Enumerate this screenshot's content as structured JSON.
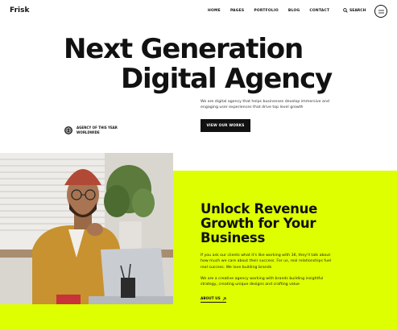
{
  "header": {
    "logo": "Frisk",
    "nav": [
      "HOME",
      "PAGES",
      "PORTFOLIO",
      "BLOG",
      "CONTACT"
    ],
    "search_label": "SEARCH"
  },
  "hero": {
    "line1": "Next Generation",
    "line2": "Digital Agency",
    "description": "We are digital agency that helps businesses develop immersive and engaging user experiences that drive top level growth",
    "cta_label": "VIEW OUR WORKS",
    "award_line1": "AGENCY OF THIS YEAR",
    "award_line2": "WORLDWIDE"
  },
  "section": {
    "title_line1": "Unlock Revenue",
    "title_line2": "Growth for Your",
    "title_line3": "Business",
    "paragraph1": "If you ask our clients what it's like working with 36, they'll talk about how much we care about their success. For us, real relationships fuel real success. We love building brands",
    "paragraph2": "We are a creative agency working with brands building insightful strategy, creating unique designs and crafting value",
    "link_label": "ABOUT US"
  },
  "colors": {
    "accent": "#ddff00",
    "dark": "#111111"
  }
}
